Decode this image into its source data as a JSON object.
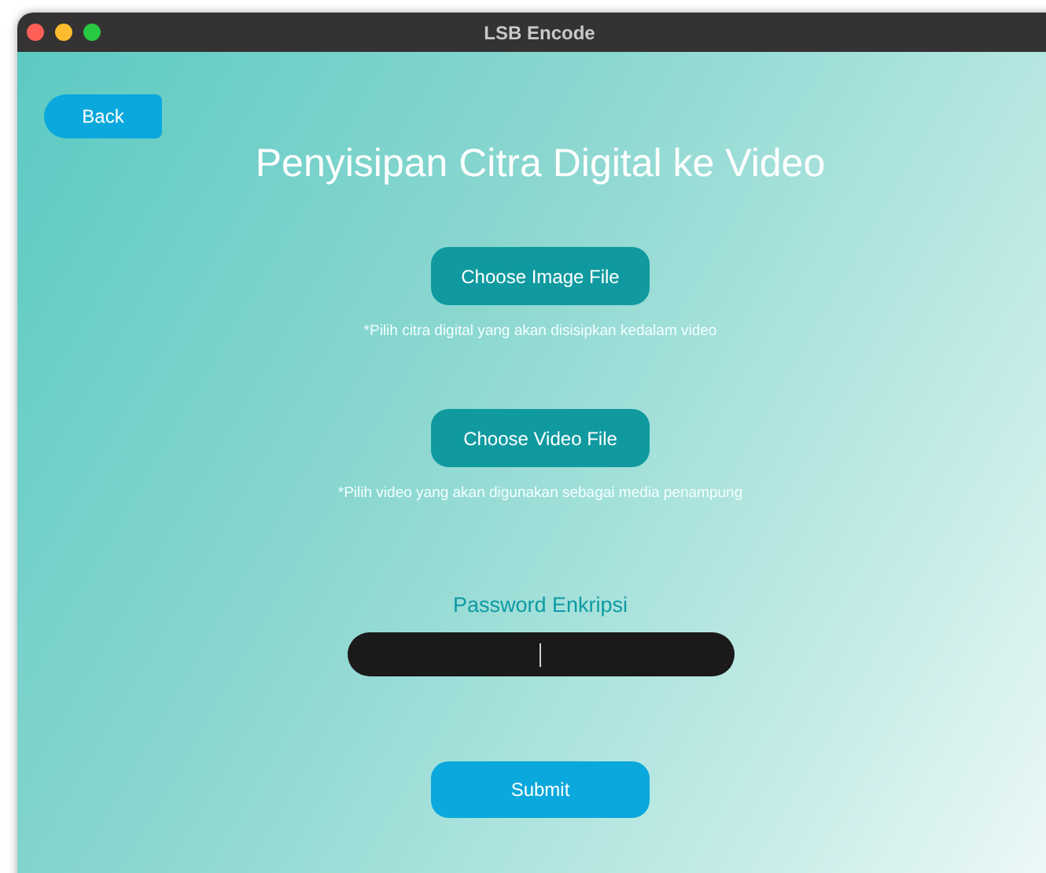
{
  "window": {
    "title": "LSB Encode"
  },
  "back_button": "Back",
  "heading": "Penyisipan Citra Digital ke Video",
  "file_pickers": [
    {
      "button": "Choose Image File",
      "hint": "*Pilih citra digital yang akan disisipkan kedalam video"
    },
    {
      "button": "Choose Video File",
      "hint": "*Pilih video yang akan digunakan sebagai media penampung"
    }
  ],
  "password": {
    "label": "Password Enkripsi",
    "focused": true
  },
  "submit_button": "Submit"
}
